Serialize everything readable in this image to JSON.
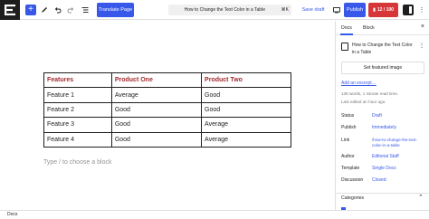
{
  "toolbar": {
    "inserter_symbol": "+",
    "translate_label": "Translate Page",
    "document_title": "How to Change the Text Color in a Table",
    "shortcut": "⌘K",
    "save_draft_label": "Save draft",
    "publish_label": "Publish",
    "score_label": "12 / 100",
    "accent_color": "#3858e9",
    "score_color": "#d63638"
  },
  "table": {
    "headers": [
      "Features",
      "Product One",
      "Product Two"
    ],
    "rows": [
      [
        "Feature 1",
        "Average",
        "Good"
      ],
      [
        "Feature 2",
        "Good",
        "Good"
      ],
      [
        "Feature 3",
        "Good",
        "Average"
      ],
      [
        "Feature 4",
        "Good",
        "Average"
      ]
    ],
    "header_color": "#a22a2f"
  },
  "canvas": {
    "appender_placeholder": "Type / to choose a block"
  },
  "sidebar": {
    "tabs": [
      "Docs",
      "Block"
    ],
    "post_title": "How to Change the Text Color in a Table",
    "featured_image_label": "Set featured image",
    "excerpt_link": "Add an excerpt…",
    "stats": "136 words, 1 minute read time.",
    "last_edited": "Last edited an hour ago.",
    "fields": [
      {
        "label": "Status",
        "value": "Draft"
      },
      {
        "label": "Publish",
        "value": "Immediately"
      },
      {
        "label": "Link",
        "value": "/how-to-change-the-text-color-in-a-table"
      },
      {
        "label": "Author",
        "value": "Editorial Staff"
      },
      {
        "label": "Template",
        "value": "Single Docs"
      },
      {
        "label": "Discussion",
        "value": "Closed"
      }
    ],
    "section_title": "Categories"
  },
  "footer": {
    "breadcrumb": "Docs"
  }
}
